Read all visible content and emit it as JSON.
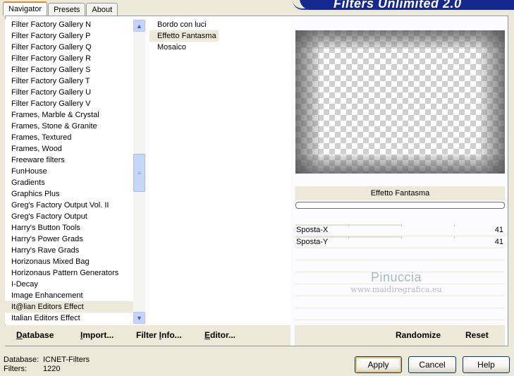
{
  "tabs": [
    "Navigator",
    "Presets",
    "About"
  ],
  "banner_title": "Filters Unlimited 2.0",
  "filter_list": [
    "Filter Factory Gallery N",
    "Filter Factory Gallery P",
    "Filter Factory Gallery Q",
    "Filter Factory Gallery R",
    "Filter Factory Gallery S",
    "Filter Factory Gallery T",
    "Filter Factory Gallery U",
    "Filter Factory Gallery V",
    "Frames, Marble & Crystal",
    "Frames, Stone & Granite",
    "Frames, Textured",
    "Frames, Wood",
    "Freeware filters",
    "FunHouse",
    "Gradients",
    "Graphics Plus",
    "Greg's Factory Output Vol. II",
    "Greg's Factory Output",
    "Harry's Button Tools",
    "Harry's Power Grads",
    "Harry's Rave Grads",
    "Horizonaus Mixed Bag",
    "Horizonaus Pattern Generators",
    "I-Decay",
    "Image Enhancement",
    "It@lian Editors Effect",
    "Italian Editors Effect"
  ],
  "filter_list_selected_index": 25,
  "effect_list": [
    "Bordo con luci",
    "Effetto Fantasma",
    "Mosaico"
  ],
  "effect_list_selected_index": 1,
  "effect_title": "Effetto Fantasma",
  "sliders": [
    {
      "label": "Sposta-X",
      "value": "41"
    },
    {
      "label": "Sposta-Y",
      "value": "41"
    }
  ],
  "watermark": {
    "line1": "Pinuccia",
    "line2": "www.maidiregrafica.eu"
  },
  "toolbar_left": [
    {
      "prefix": "",
      "accel": "D",
      "rest": "atabase"
    },
    {
      "prefix": "",
      "accel": "I",
      "rest": "mport..."
    },
    {
      "prefix": "Filter ",
      "accel": "I",
      "rest": "nfo..."
    },
    {
      "prefix": "",
      "accel": "E",
      "rest": "ditor..."
    }
  ],
  "toolbar_right": {
    "randomize": "Randomize",
    "reset": "Reset"
  },
  "status": {
    "database_label": "Database:",
    "database_value": "ICNET-Filters",
    "filters_label": "Filters:",
    "filters_value": "1220"
  },
  "buttons": {
    "apply": "Apply",
    "cancel": "Cancel",
    "help": "Help"
  },
  "colors": {
    "banner": "#14288f",
    "panel": "#ece9d8",
    "tab_highlight": "#e68b2c"
  }
}
